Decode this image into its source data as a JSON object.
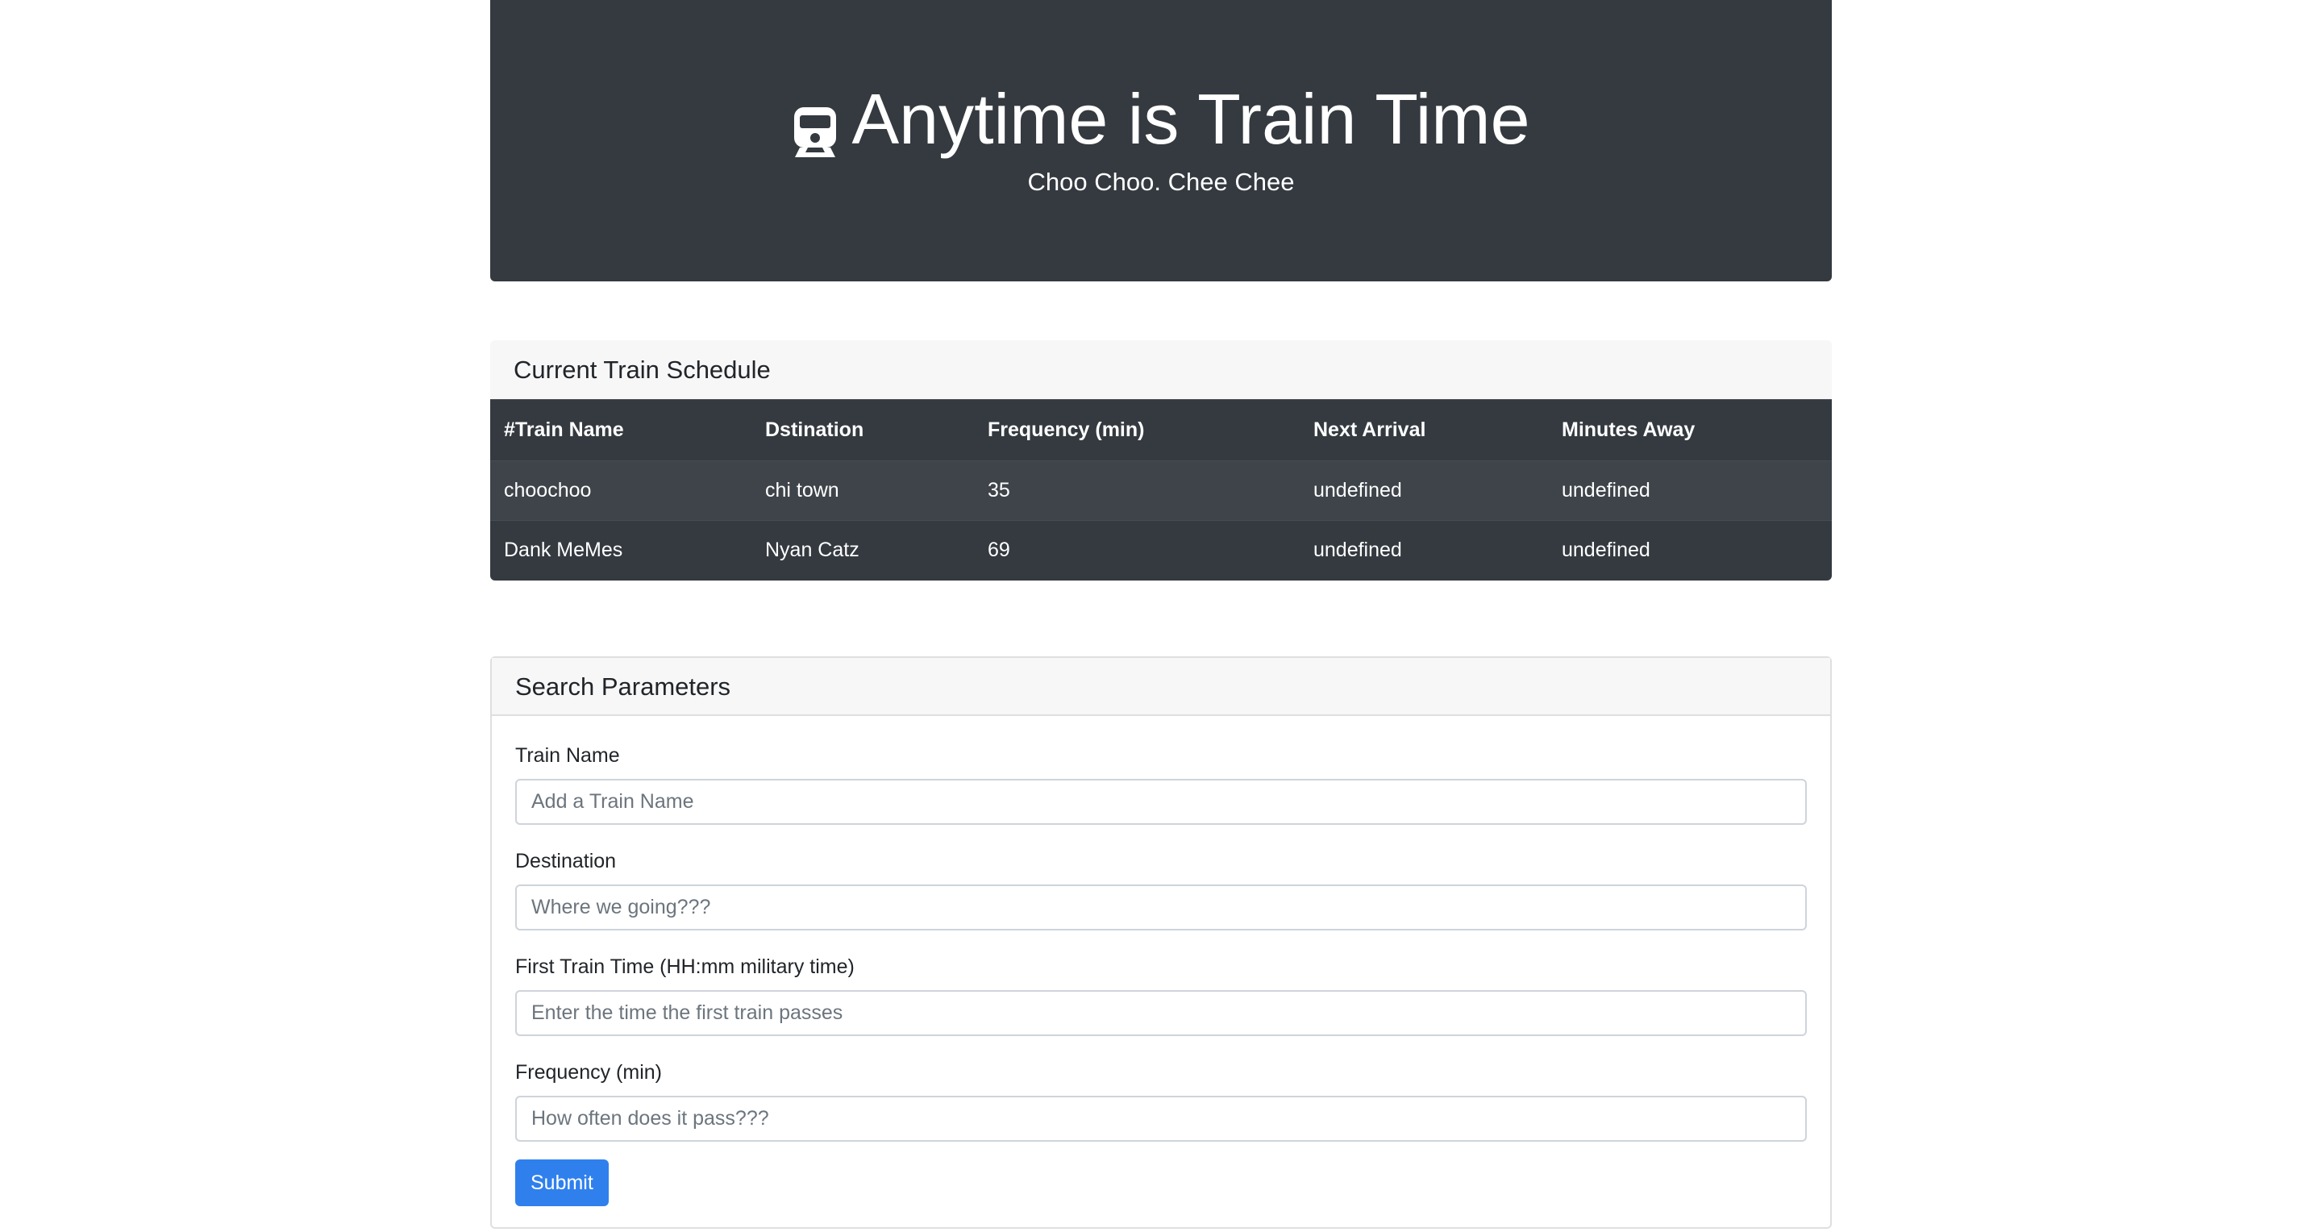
{
  "header": {
    "title": "Anytime is Train Time",
    "subtitle": "Choo Choo. Chee Chee",
    "icon": "train-icon"
  },
  "schedule": {
    "heading": "Current Train Schedule",
    "columns": [
      "#Train Name",
      "Dstination",
      "Frequency (min)",
      "Next Arrival",
      "Minutes Away"
    ],
    "rows": [
      [
        "choochoo",
        "chi town",
        "35",
        "undefined",
        "undefined"
      ],
      [
        "Dank MeMes",
        "Nyan Catz",
        "69",
        "undefined",
        "undefined"
      ]
    ]
  },
  "search": {
    "heading": "Search Parameters",
    "fields": [
      {
        "label": "Train Name",
        "placeholder": "Add a Train Name",
        "value": ""
      },
      {
        "label": "Destination",
        "placeholder": "Where we going???",
        "value": ""
      },
      {
        "label": "First Train Time (HH:mm military time)",
        "placeholder": "Enter the time the first train passes",
        "value": ""
      },
      {
        "label": "Frequency (min)",
        "placeholder": "How often does it pass???",
        "value": ""
      }
    ],
    "submit_label": "Submit"
  },
  "colors": {
    "dark": "#343a40",
    "stripe": "#3e444a",
    "card_header": "#f7f7f7",
    "primary": "#2f80ed"
  }
}
